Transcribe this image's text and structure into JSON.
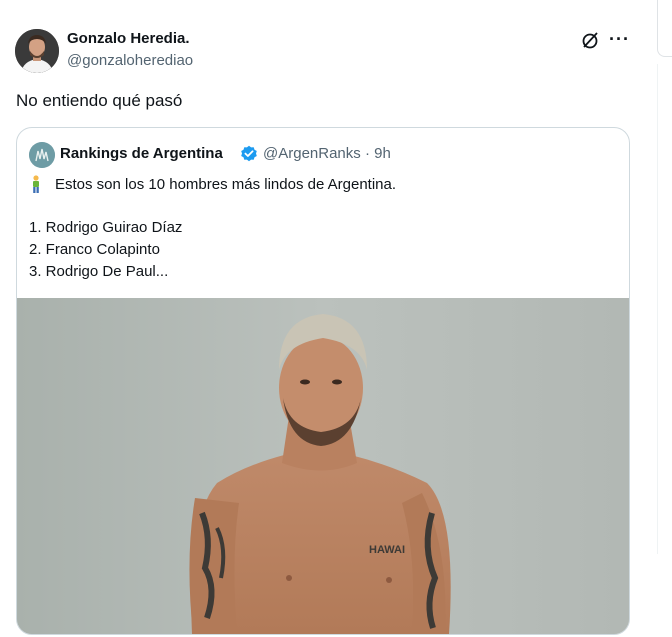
{
  "author": {
    "display_name": "Gonzalo Heredia.",
    "handle": "@gonzaloherediao"
  },
  "tweet": {
    "text": "No entiendo qué pasó"
  },
  "quoted_tweet": {
    "display_name": "Rankings de Argentina",
    "handle_time": "@ArgenRanks · 9h",
    "intro": "Estos son los 10 hombres más lindos de Argentina.",
    "list": [
      "1. Rodrigo Guirao Díaz",
      "2. Franco Colapinto",
      "3. Rodrigo De Paul..."
    ],
    "tattoo_text": "HAWAI"
  },
  "icons": {
    "grok": "grok-icon",
    "more": "more-icon",
    "verified": "verified-icon",
    "person": "person-icon"
  },
  "colors": {
    "verified": "#1d9bf0",
    "secondary_text": "#536471",
    "border": "#cfd9de"
  }
}
